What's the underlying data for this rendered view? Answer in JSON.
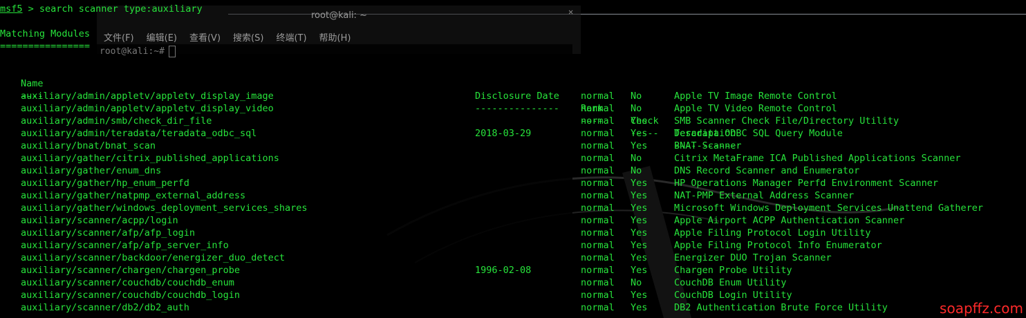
{
  "terminal": {
    "prompt_app": "msf5",
    "prompt_sep": " > ",
    "command": "search scanner type:auxiliary",
    "section_title": "Matching Modules",
    "section_rule": "================",
    "headers": {
      "name": "Name",
      "date": "Disclosure Date",
      "rank": "Rank",
      "check": "Check",
      "desc": "Description"
    },
    "underlines": {
      "name": "----",
      "date": "---------------",
      "rank": "----",
      "check": "-----",
      "desc": "-----------"
    },
    "rows": [
      {
        "name": "auxiliary/admin/appletv/appletv_display_image",
        "date": "",
        "rank": "normal",
        "check": "No",
        "desc": "Apple TV Image Remote Control"
      },
      {
        "name": "auxiliary/admin/appletv/appletv_display_video",
        "date": "",
        "rank": "normal",
        "check": "No",
        "desc": "Apple TV Video Remote Control"
      },
      {
        "name": "auxiliary/admin/smb/check_dir_file",
        "date": "",
        "rank": "normal",
        "check": "Yes",
        "desc": "SMB Scanner Check File/Directory Utility"
      },
      {
        "name": "auxiliary/admin/teradata/teradata_odbc_sql",
        "date": "2018-03-29",
        "rank": "normal",
        "check": "Yes",
        "desc": "Teradata ODBC SQL Query Module"
      },
      {
        "name": "auxiliary/bnat/bnat_scan",
        "date": "",
        "rank": "normal",
        "check": "Yes",
        "desc": "BNAT Scanner"
      },
      {
        "name": "auxiliary/gather/citrix_published_applications",
        "date": "",
        "rank": "normal",
        "check": "No",
        "desc": "Citrix MetaFrame ICA Published Applications Scanner"
      },
      {
        "name": "auxiliary/gather/enum_dns",
        "date": "",
        "rank": "normal",
        "check": "No",
        "desc": "DNS Record Scanner and Enumerator"
      },
      {
        "name": "auxiliary/gather/hp_enum_perfd",
        "date": "",
        "rank": "normal",
        "check": "Yes",
        "desc": "HP Operations Manager Perfd Environment Scanner"
      },
      {
        "name": "auxiliary/gather/natpmp_external_address",
        "date": "",
        "rank": "normal",
        "check": "Yes",
        "desc": "NAT-PMP External Address Scanner"
      },
      {
        "name": "auxiliary/gather/windows_deployment_services_shares",
        "date": "",
        "rank": "normal",
        "check": "Yes",
        "desc": "Microsoft Windows Deployment Services Unattend Gatherer"
      },
      {
        "name": "auxiliary/scanner/acpp/login",
        "date": "",
        "rank": "normal",
        "check": "Yes",
        "desc": "Apple Airport ACPP Authentication Scanner"
      },
      {
        "name": "auxiliary/scanner/afp/afp_login",
        "date": "",
        "rank": "normal",
        "check": "Yes",
        "desc": "Apple Filing Protocol Login Utility"
      },
      {
        "name": "auxiliary/scanner/afp/afp_server_info",
        "date": "",
        "rank": "normal",
        "check": "Yes",
        "desc": "Apple Filing Protocol Info Enumerator"
      },
      {
        "name": "auxiliary/scanner/backdoor/energizer_duo_detect",
        "date": "",
        "rank": "normal",
        "check": "Yes",
        "desc": "Energizer DUO Trojan Scanner"
      },
      {
        "name": "auxiliary/scanner/chargen/chargen_probe",
        "date": "1996-02-08",
        "rank": "normal",
        "check": "Yes",
        "desc": "Chargen Probe Utility"
      },
      {
        "name": "auxiliary/scanner/couchdb/couchdb_enum",
        "date": "",
        "rank": "normal",
        "check": "No",
        "desc": "CouchDB Enum Utility"
      },
      {
        "name": "auxiliary/scanner/couchdb/couchdb_login",
        "date": "",
        "rank": "normal",
        "check": "Yes",
        "desc": "CouchDB Login Utility"
      },
      {
        "name": "auxiliary/scanner/db2/db2_auth",
        "date": "",
        "rank": "normal",
        "check": "Yes",
        "desc": "DB2 Authentication Brute Force Utility"
      }
    ]
  },
  "ghost_window": {
    "title": "root@kali: ~",
    "menu": [
      "文件(F)",
      "编辑(E)",
      "查看(V)",
      "搜索(S)",
      "终端(T)",
      "帮助(H)"
    ],
    "prompt": "root@kali:~#"
  },
  "watermark": "soapffz.com",
  "colors": {
    "terminal_text": "#27e33b",
    "background": "#000000",
    "watermark": "#ff2a2a"
  }
}
